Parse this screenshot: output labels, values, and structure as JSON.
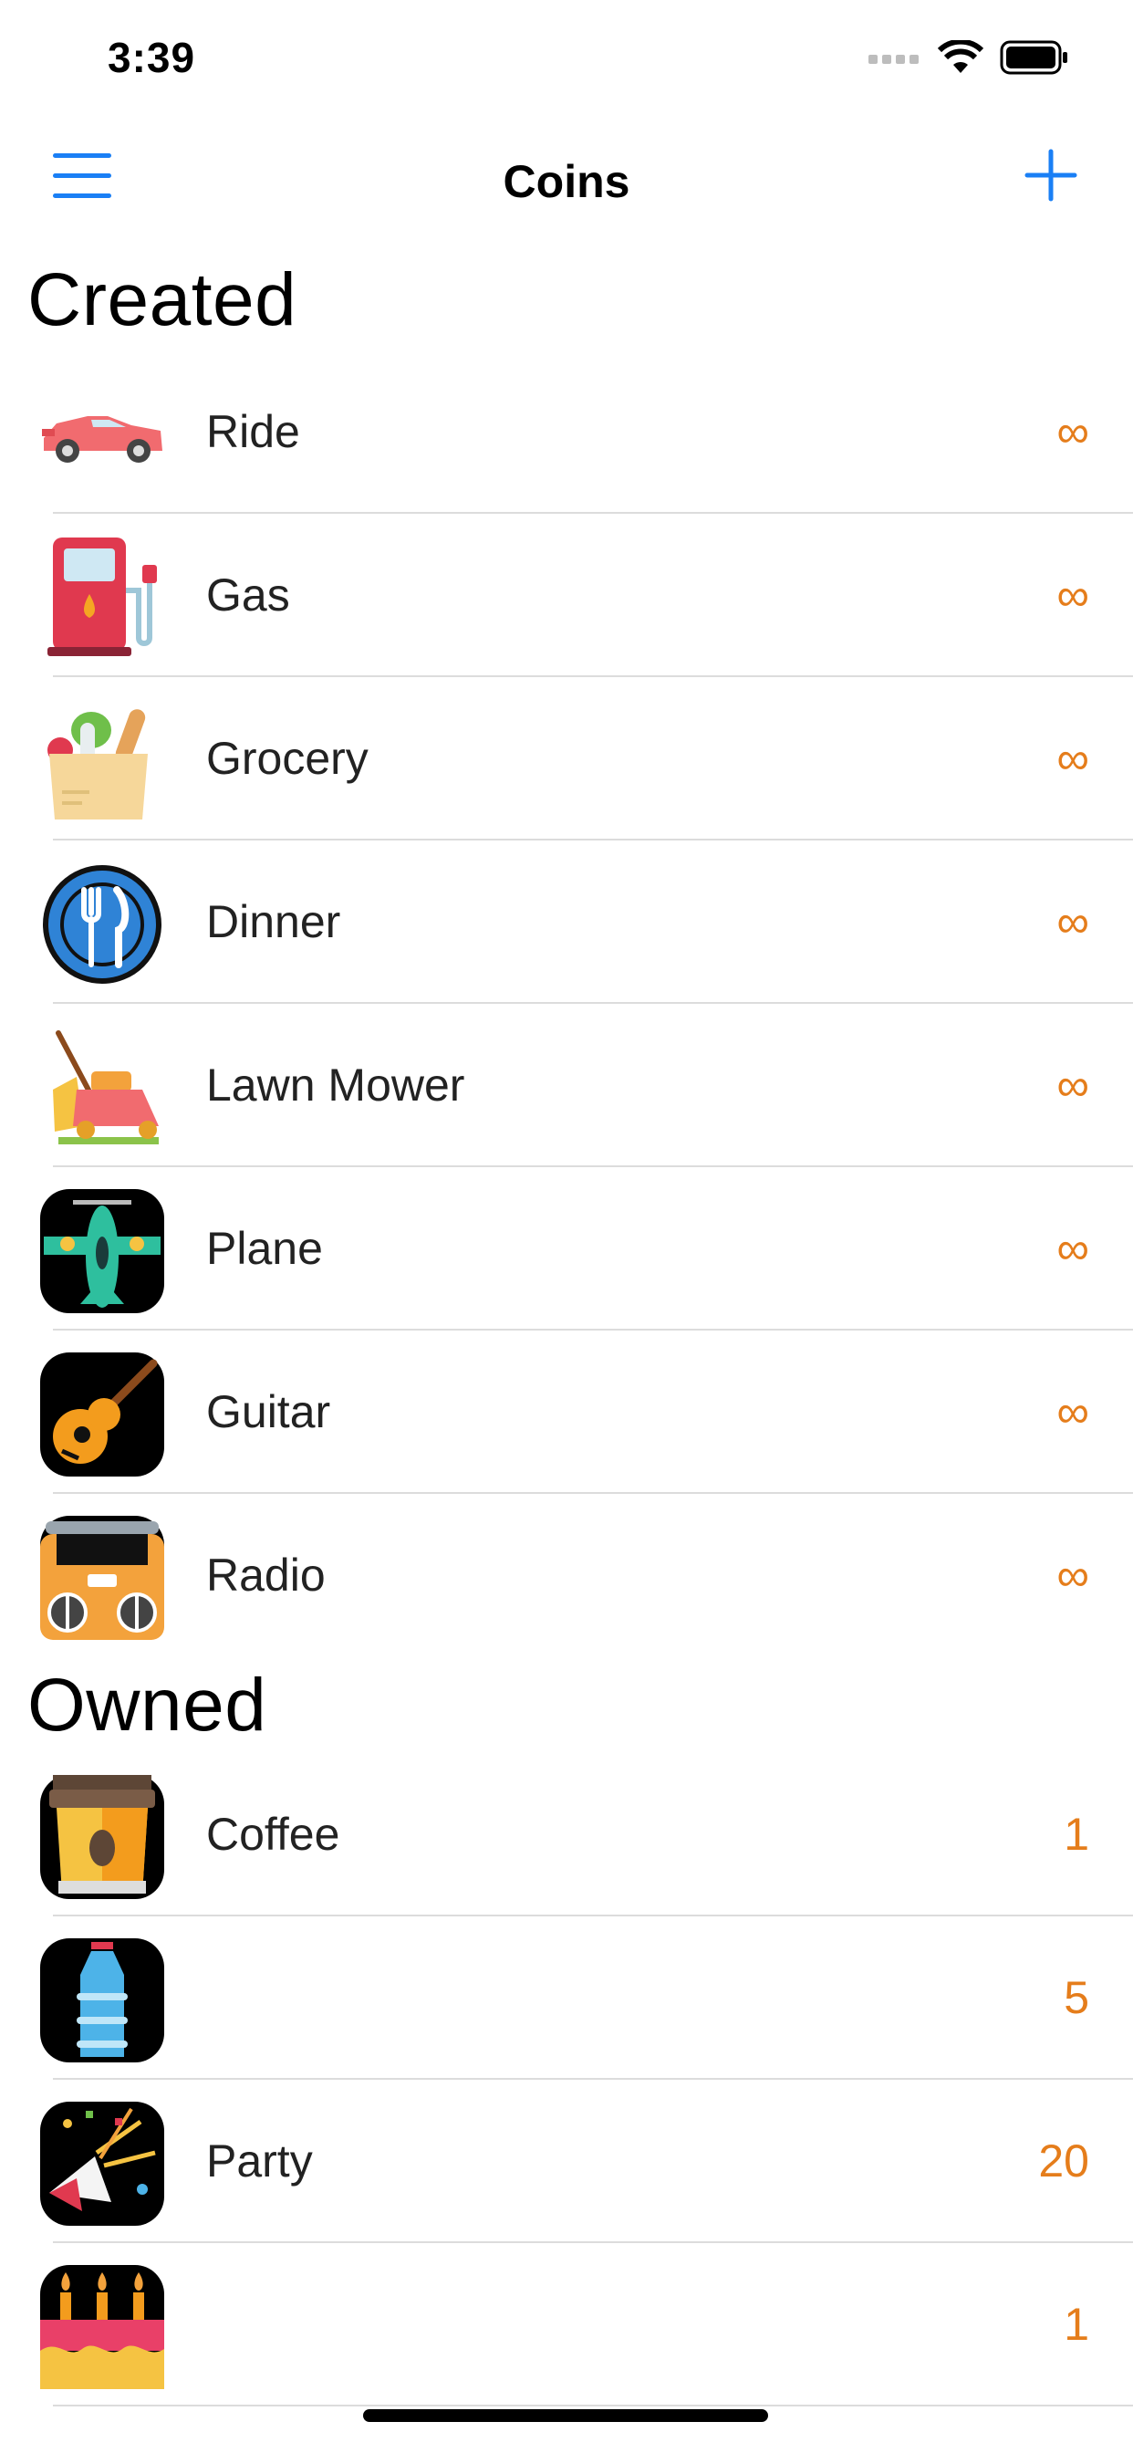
{
  "status": {
    "time": "3:39"
  },
  "navbar": {
    "title": "Coins"
  },
  "sections": {
    "created": {
      "title": "Created",
      "items": [
        {
          "label": "Ride",
          "value": "∞",
          "icon": "race-car-icon"
        },
        {
          "label": "Gas",
          "value": "∞",
          "icon": "gas-pump-icon"
        },
        {
          "label": "Grocery",
          "value": "∞",
          "icon": "grocery-bag-icon"
        },
        {
          "label": "Dinner",
          "value": "∞",
          "icon": "fork-knife-plate-icon"
        },
        {
          "label": "Lawn Mower",
          "value": "∞",
          "icon": "lawn-mower-icon"
        },
        {
          "label": "Plane",
          "value": "∞",
          "icon": "plane-icon"
        },
        {
          "label": "Guitar",
          "value": "∞",
          "icon": "guitar-icon"
        },
        {
          "label": "Radio",
          "value": "∞",
          "icon": "boombox-radio-icon"
        }
      ]
    },
    "owned": {
      "title": "Owned",
      "items": [
        {
          "label": "Coffee",
          "value": "1",
          "icon": "coffee-cup-icon"
        },
        {
          "label": "",
          "value": "5",
          "icon": "water-bottle-icon"
        },
        {
          "label": "Party",
          "value": "20",
          "icon": "party-popper-icon"
        },
        {
          "label": "",
          "value": "1",
          "icon": "birthday-cake-icon"
        }
      ]
    }
  },
  "colors": {
    "accent": "#1a7ff5",
    "value": "#e57d1b",
    "divider": "#dcdcdc"
  }
}
